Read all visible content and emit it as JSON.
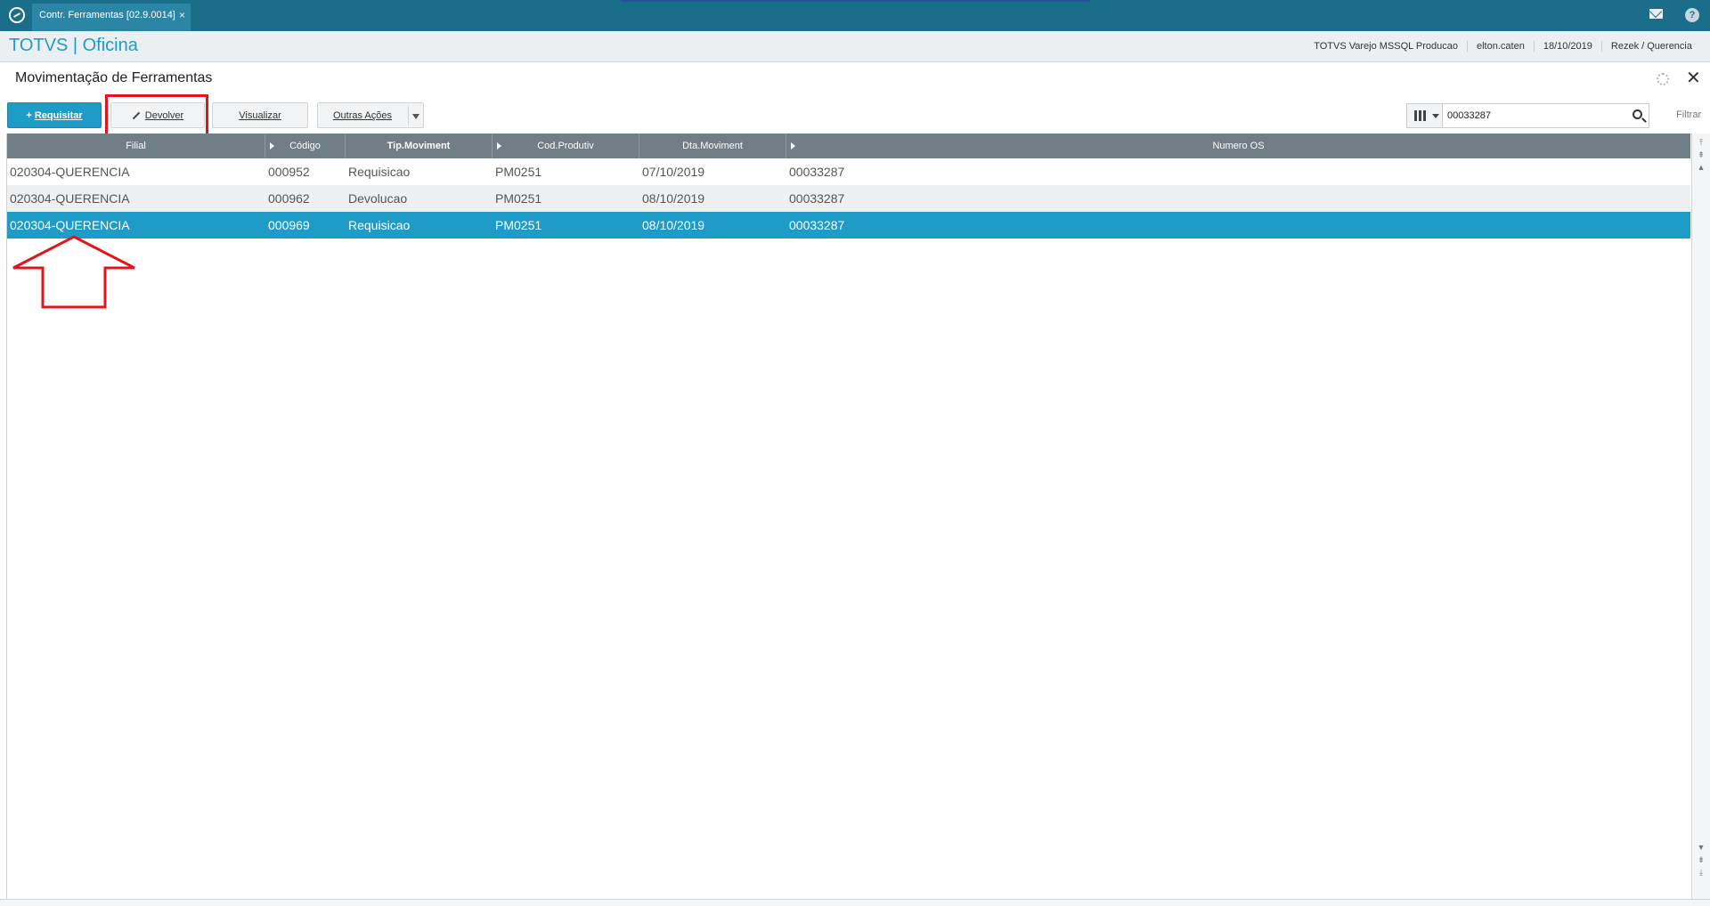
{
  "topbar": {
    "tab_title": "Contr. Ferramentas [02.9.0014]",
    "tab_close": "×",
    "help_label": "?"
  },
  "header": {
    "brand": "TOTVS | Oficina",
    "environment": "TOTVS Varejo MSSQL Producao",
    "user": "elton.caten",
    "date": "18/10/2019",
    "branch": "Rezek / Querencia"
  },
  "page": {
    "title": "Movimentação de Ferramentas",
    "close_label": "✕"
  },
  "toolbar": {
    "requisitar": "Requisitar",
    "devolver": "Devolver",
    "visualizar": "Visualizar",
    "outras_acoes": "Outras Ações",
    "filtrar": "Filtrar"
  },
  "search": {
    "value": "00033287"
  },
  "grid": {
    "columns": [
      "Filial",
      "Código",
      "Tip.Moviment",
      "Cod.Produtiv",
      "Dta.Moviment",
      "Numero OS"
    ],
    "rows": [
      [
        "020304-QUERENCIA",
        "000952",
        "Requisicao",
        "PM0251",
        "07/10/2019",
        "00033287"
      ],
      [
        "020304-QUERENCIA",
        "000962",
        "Devolucao",
        "PM0251",
        "08/10/2019",
        "00033287"
      ],
      [
        "020304-QUERENCIA",
        "000969",
        "Requisicao",
        "PM0251",
        "08/10/2019",
        "00033287"
      ]
    ],
    "selected_row": 2
  },
  "colors": {
    "accent": "#1e9bc6",
    "titlebar": "#1a6e8a",
    "grid_header": "#707e85",
    "annotation": "#e0161b"
  }
}
